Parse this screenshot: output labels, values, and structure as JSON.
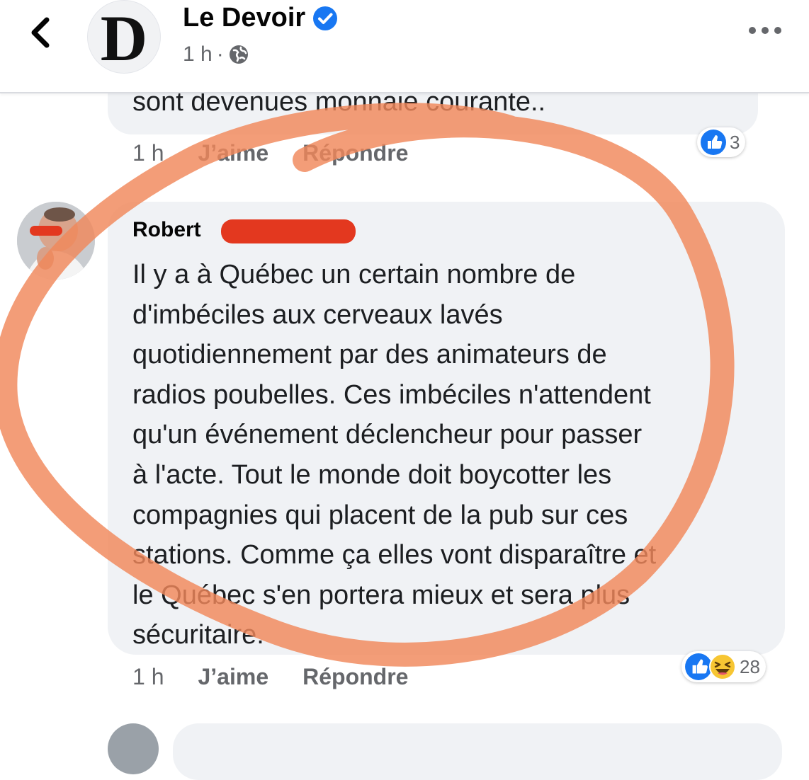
{
  "header": {
    "page_initial": "D",
    "page_name": "Le Devoir",
    "time": "1 h",
    "separator": "·"
  },
  "previous_comment": {
    "text_tail": "sont devenues monnaie courante..",
    "time": "1 h",
    "like_label": "J’aime",
    "reply_label": "Répondre",
    "reaction_count": "3"
  },
  "comment": {
    "author": "Robert",
    "text": "Il y a à Québec un certain nombre de\nd'imbéciles aux cerveaux lavés\nquotidiennement par des animateurs de\nradios poubelles. Ces imbéciles n'attendent\nqu'un événement déclencheur pour passer\nà l'acte.  Tout le monde doit boycotter les\ncompagnies qui placent de la pub sur ces\nstations. Comme ça elles vont disparaître et\nle Québec s'en portera mieux et sera plus\nsécuritaire.",
    "time": "1 h",
    "like_label": "J’aime",
    "reply_label": "Répondre",
    "reaction_count": "28"
  },
  "colors": {
    "accent": "#1877f2",
    "bubble": "#f0f2f5",
    "meta": "#65676b",
    "annotation": "#f0875a",
    "redaction": "#e3381f"
  },
  "icons": [
    "back-arrow-icon",
    "verified-badge-icon",
    "globe-icon",
    "more-options-icon",
    "like-reaction-icon",
    "haha-reaction-icon"
  ]
}
